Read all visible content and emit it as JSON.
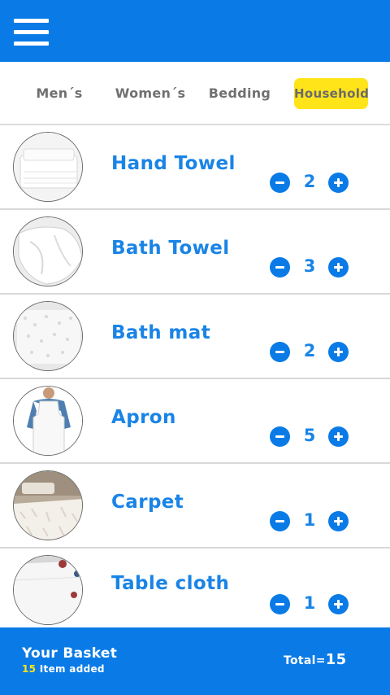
{
  "header": {
    "menu_icon": "hamburger-menu-icon"
  },
  "tabs": [
    {
      "label": "Men´s",
      "active": false
    },
    {
      "label": "Women´s",
      "active": false
    },
    {
      "label": "Bedding",
      "active": false
    },
    {
      "label": "Household",
      "active": true
    }
  ],
  "colors": {
    "primary": "#0a7be6",
    "active_tab": "#ffe41a",
    "item_text": "#1a84e6"
  },
  "items": [
    {
      "name": "Hand Towel",
      "qty": "2",
      "image": "hand-towel-image"
    },
    {
      "name": "Bath Towel",
      "qty": "3",
      "image": "bath-towel-image"
    },
    {
      "name": "Bath mat",
      "qty": "2",
      "image": "bath-mat-image"
    },
    {
      "name": "Apron",
      "qty": "5",
      "image": "apron-image"
    },
    {
      "name": "Carpet",
      "qty": "1",
      "image": "carpet-image"
    },
    {
      "name": "Table cloth",
      "qty": "1",
      "image": "table-cloth-image"
    }
  ],
  "footer": {
    "title": "Your Basket",
    "count": "15",
    "added_text": " Item added",
    "total_label": "Total=",
    "total_value": "15"
  }
}
